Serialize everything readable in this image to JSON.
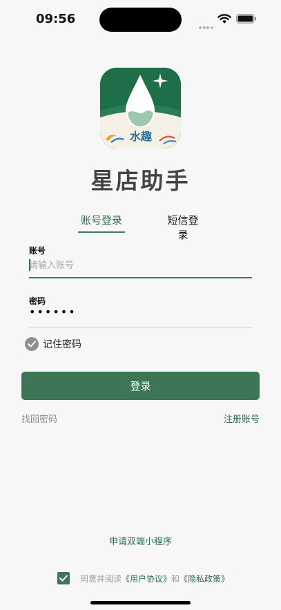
{
  "status_bar": {
    "time": "09:56"
  },
  "logo": {
    "brand_text": "水趣",
    "colors": {
      "primary": "#1d6e49",
      "light": "#f4f1e4"
    }
  },
  "app_title": "星店助手",
  "tabs": [
    {
      "label": "账号登录",
      "active": true
    },
    {
      "label": "短信登录",
      "active": false
    }
  ],
  "form": {
    "account": {
      "label": "账号",
      "placeholder": "请输入账号",
      "value": ""
    },
    "password": {
      "label": "密码",
      "masked_value": "••••••"
    },
    "remember": {
      "label": "记住密码",
      "checked": true
    },
    "submit_label": "登录"
  },
  "links": {
    "forgot": "找回密码",
    "register": "注册账号",
    "miniapp": "申请双端小程序"
  },
  "agreement": {
    "checked": true,
    "prefix": "同意并阅读",
    "user_agreement": "《用户协议》",
    "conjunction": "和",
    "privacy_policy": "《隐私政策》"
  },
  "theme": {
    "accent": "#3c7656",
    "accent_text": "#2f6a4b",
    "background": "#f7f7f7"
  }
}
